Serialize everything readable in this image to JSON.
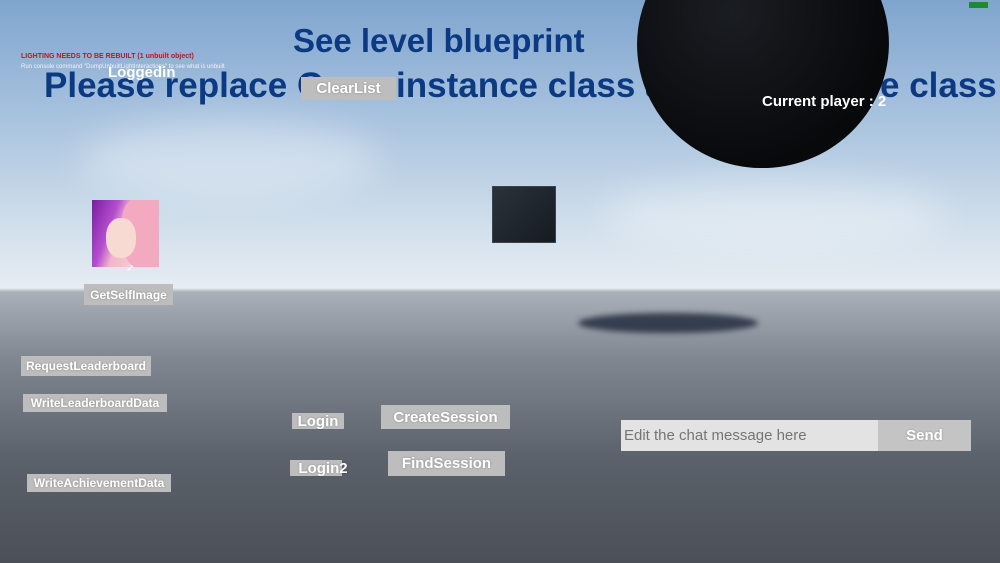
{
  "warnings": {
    "lighting": "LIGHTING NEEDS TO BE REBUILT (1 unbuilt object)",
    "console_hint": "Run console command \"DumpUnbuiltLightInteractions\" to see what is unbuilt"
  },
  "status": {
    "logged_in": "Loggedin",
    "current_player": "Current player : 2"
  },
  "headings": {
    "blueprint": "See level blueprint",
    "replace_part1": "Please replace G",
    "replace_part2": "instance class a",
    "replace_part3": "e class fo"
  },
  "buttons": {
    "clear_list": "ClearList",
    "get_self_image": "GetSelfImage",
    "request_leaderboard": "RequestLeaderboard",
    "write_leaderboard": "WriteLeaderboardData",
    "write_achievement": "WriteAchievementData",
    "login": "Login",
    "login2": "Login2",
    "create_session": "CreateSession",
    "find_session": "FindSession",
    "send": "Send"
  },
  "chat": {
    "placeholder": "Edit the chat message here",
    "value": ""
  },
  "colors": {
    "heading": "#0b3a82",
    "warning": "#cc1111",
    "button": "#bdbdbd",
    "fps": "#1e8a2e"
  }
}
